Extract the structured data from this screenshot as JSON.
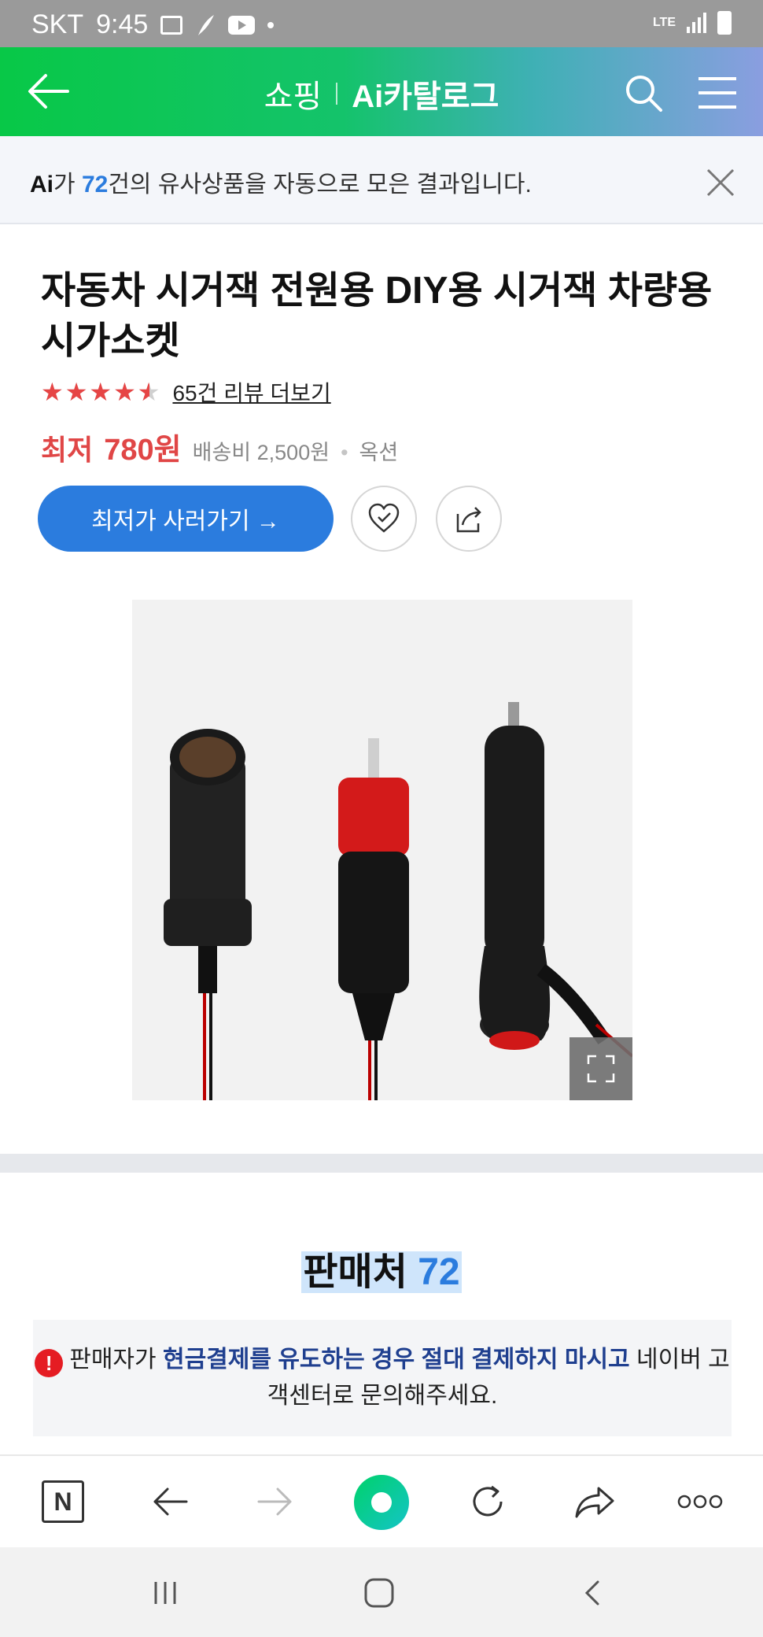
{
  "status_bar": {
    "carrier": "SKT",
    "time": "9:45",
    "network": "LTE",
    "icons": [
      "image-icon",
      "feather-icon",
      "youtube-icon",
      "dot-icon",
      "signal-icon",
      "battery-icon"
    ]
  },
  "header": {
    "shop_label": "쇼핑",
    "catalog_label": "Ai카탈로그",
    "icons": [
      "back-arrow-icon",
      "search-icon",
      "menu-icon"
    ]
  },
  "ai_banner": {
    "logo": "Ai",
    "text_prefix": "가 ",
    "count": "72",
    "text_suffix": "건의 유사상품을 자동으로 모은 결과입니다."
  },
  "product": {
    "title": "자동차 시거잭 전원용 DIY용 시거잭 차량용 시가소켓",
    "rating": 4.5,
    "stars": "★★★★★",
    "reviews_label": "65건 리뷰 더보기",
    "price_label": "최저",
    "price_value": "780원",
    "shipping": "배송비 2,500원",
    "dot": "•",
    "option": "옥션",
    "buy_label": "최저가 사러가기 →"
  },
  "sellers": {
    "title": "판매처",
    "count": "72"
  },
  "warning": {
    "icon": "!",
    "part1": "판매자가 ",
    "strong1": "현금결제를 유도하는 경우 절대 결제하지 마시고",
    "part2": " 네이버 고객센터로 문의해주세요."
  },
  "browser_toolbar": {
    "n_label": "N",
    "icons": [
      "naver-home-icon",
      "back-icon",
      "forward-icon",
      "green-dot-icon",
      "refresh-icon",
      "share-icon",
      "more-icon"
    ]
  },
  "colors": {
    "accent_blue": "#2b7cde",
    "price_red": "#e04646",
    "header_green": "#08c847"
  }
}
